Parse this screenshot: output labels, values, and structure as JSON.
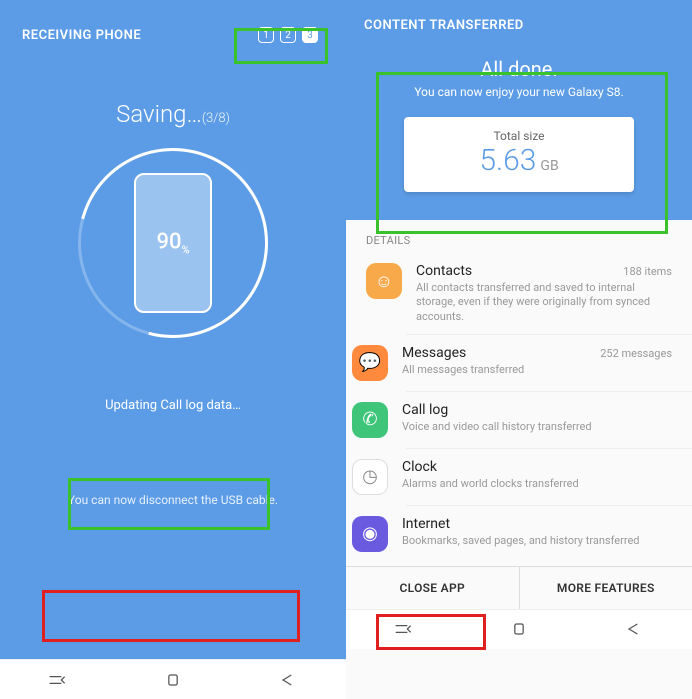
{
  "left": {
    "title": "RECEIVING PHONE",
    "steps": [
      "1",
      "2",
      "3"
    ],
    "saving": "Saving…",
    "counter": "(3/8)",
    "percent": "90",
    "percent_unit": "%",
    "status": "Updating Call log data…",
    "disconnect": "You can now disconnect the USB cable."
  },
  "right": {
    "title": "CONTENT TRANSFERRED",
    "done": "All done.",
    "done_sub": "You can now enjoy your new Galaxy S8.",
    "size_label": "Total size",
    "size_value": "5.63",
    "size_unit": "GB",
    "details": "DETAILS",
    "items": [
      {
        "name": "Contacts",
        "meta": "188 items",
        "desc": "All contacts transferred and saved to internal storage, even if they were originally from synced accounts."
      },
      {
        "name": "Messages",
        "meta": "252 messages",
        "desc": "All messages transferred"
      },
      {
        "name": "Call log",
        "meta": "",
        "desc": "Voice and video call history transferred"
      },
      {
        "name": "Clock",
        "meta": "",
        "desc": "Alarms and world clocks transferred"
      },
      {
        "name": "Internet",
        "meta": "",
        "desc": "Bookmarks, saved pages, and history transferred"
      }
    ],
    "close": "CLOSE APP",
    "more": "MORE FEATURES"
  }
}
